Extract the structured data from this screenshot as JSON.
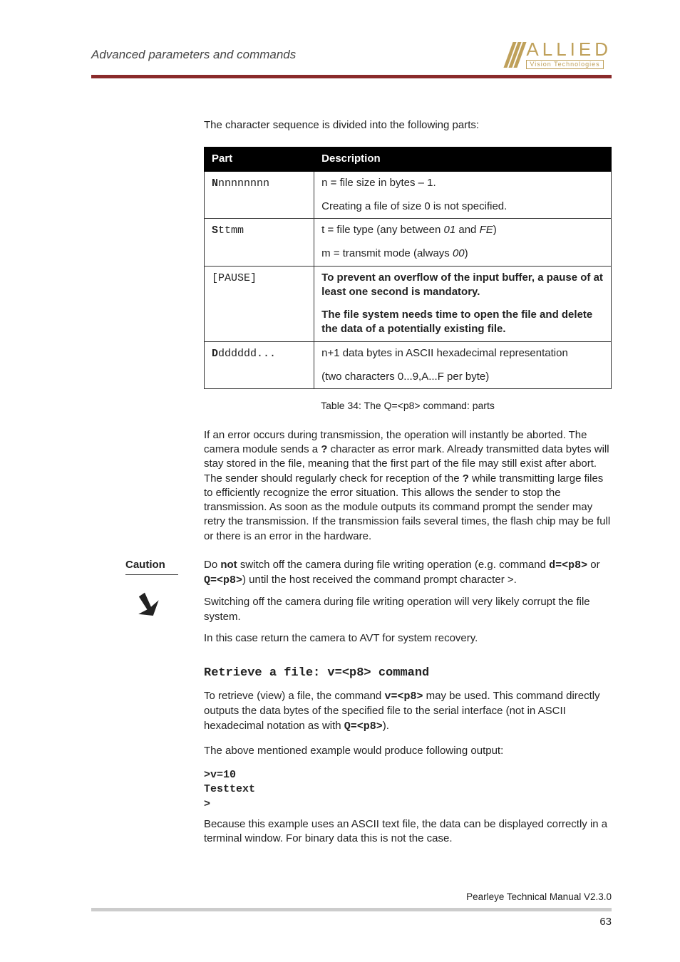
{
  "header": {
    "title": "Advanced parameters and commands"
  },
  "logo": {
    "main": "ALLIED",
    "sub": "Vision Technologies"
  },
  "intro": "The character sequence is divided into the following parts:",
  "table": {
    "head": {
      "part": "Part",
      "desc": "Description"
    },
    "rows": [
      {
        "part_pre": "N",
        "part_suf": "nnnnnnnn",
        "lines": [
          {
            "plain": "n = file size in bytes – 1."
          },
          {
            "plain": "Creating a file of size 0 is not specified."
          }
        ]
      },
      {
        "part_pre": "S",
        "part_suf": "ttmm",
        "lines": [
          {
            "pre": "t = file type (any between ",
            "ital": "01",
            "mid": " and ",
            "ital2": "FE",
            "post": ")"
          },
          {
            "pre": "m = transmit mode (always ",
            "ital": "00",
            "post": ")"
          }
        ]
      },
      {
        "part_plain": "[PAUSE]",
        "lines": [
          {
            "bold": "To prevent an overflow of the input buffer, a pause of at least one second is mandatory."
          },
          {
            "bold": "The file system needs time to open the file and delete the data of a potentially existing file."
          }
        ]
      },
      {
        "part_pre": "D",
        "part_suf": "dddddd...",
        "lines": [
          {
            "plain": "n+1 data bytes in ASCII hexadecimal representation"
          },
          {
            "plain": "(two characters 0...9,A...F per byte)"
          }
        ]
      }
    ],
    "caption": "Table 34: The Q=<p8> command: parts"
  },
  "para1": {
    "a": "If an error occurs during transmission, the operation will instantly be aborted. The camera module sends a ",
    "b": "?",
    "c": " character as error mark. Already transmitted data bytes will stay stored in the file, meaning that the first part of the file may still exist after abort. The sender should regularly check for reception of the ",
    "d": "?",
    "e": " while transmitting large files to efficiently recognize the error situation. This allows the sender to stop the transmission. As soon as the module outputs its command prompt the sender may retry the transmission. If the transmission fails several times, the flash chip may be full or there is an error in the hardware."
  },
  "caution": {
    "label": "Caution",
    "p1a": "Do ",
    "p1b": "not",
    "p1c": " switch off the camera during file writing operation (e.g. command  ",
    "p1d": "d=<p8>",
    "p1e": "  or  ",
    "p1f": "Q=<p8>",
    "p1g": ") until the host received the command prompt character >.",
    "p2": "Switching off the camera during file writing operation will very likely corrupt the file system.",
    "p3": "In this case return the camera to AVT for system recovery."
  },
  "section2": {
    "head": "Retrieve a file: v=<p8> command",
    "p1a": "To retrieve (view) a file, the command  ",
    "p1b": "v=<p8>",
    "p1c": "  may be used. This command directly outputs the data bytes of the specified file to the serial interface (not in ASCII hexadecimal notation as with  ",
    "p1d": "Q=<p8>",
    "p1e": ").",
    "p2": "The above mentioned example would produce following output:",
    "code": ">v=10\nTesttext\n>",
    "p3": "Because this example uses an ASCII text file, the data can be displayed correctly in a terminal window. For binary data this is not the case."
  },
  "footer": {
    "text": "Pearleye Technical Manual V2.3.0",
    "page": "63"
  }
}
